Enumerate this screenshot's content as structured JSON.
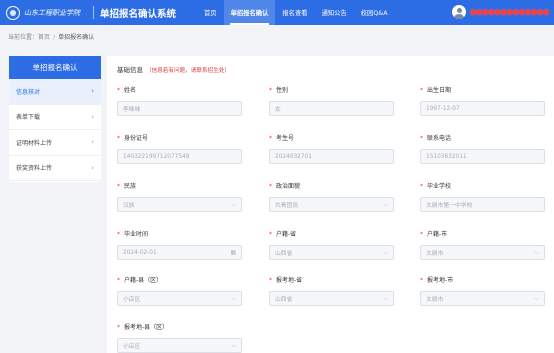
{
  "header": {
    "school_name": "山东工程职业学院",
    "system_title": "单招报名确认系统",
    "nav": [
      {
        "label": "首页",
        "active": false
      },
      {
        "label": "单招报名确认",
        "active": true
      },
      {
        "label": "报名查看",
        "active": false
      },
      {
        "label": "通知公告",
        "active": false
      },
      {
        "label": "校园Q&A",
        "active": false
      }
    ],
    "user_name": "●●●●●●●●●●●●●"
  },
  "breadcrumb": {
    "prefix": "当前位置：",
    "home": "首页",
    "separator": "/",
    "current": "单招报名确认"
  },
  "sidebar": {
    "title": "单招报名确认",
    "items": [
      {
        "label": "信息核对",
        "active": true
      },
      {
        "label": "表单下载",
        "active": false
      },
      {
        "label": "证明材料上传",
        "active": false
      },
      {
        "label": "获奖资料上传",
        "active": false
      }
    ]
  },
  "form": {
    "section_title": "基础信息",
    "note": "（信息若有问题，请联系招生处）",
    "fields": [
      {
        "label": "姓名",
        "value": "李咪咪",
        "type": "text"
      },
      {
        "label": "性别",
        "value": "女",
        "type": "text"
      },
      {
        "label": "出生日期",
        "value": "1997-12-07",
        "type": "text"
      },
      {
        "label": "身份证号",
        "value": "140322199712077548",
        "type": "text"
      },
      {
        "label": "考生号",
        "value": "2024032701",
        "type": "text"
      },
      {
        "label": "联系电话",
        "value": "15103632011",
        "type": "text"
      },
      {
        "label": "民族",
        "value": "汉族",
        "type": "select"
      },
      {
        "label": "政治面貌",
        "value": "共青团员",
        "type": "select"
      },
      {
        "label": "毕业学校",
        "value": "太原市第一中学校",
        "type": "text"
      },
      {
        "label": "毕业时间",
        "value": "2024-02-01",
        "type": "date"
      },
      {
        "label": "户籍-省",
        "value": "山西省",
        "type": "select"
      },
      {
        "label": "户籍-市",
        "value": "太原市",
        "type": "select"
      },
      {
        "label": "户籍-县（区）",
        "value": "小店区",
        "type": "select"
      },
      {
        "label": "报考地-省",
        "value": "山西省",
        "type": "select"
      },
      {
        "label": "报考地-市",
        "value": "太原市",
        "type": "select"
      },
      {
        "label": "报考地-县（区）",
        "value": "小店区",
        "type": "select"
      }
    ]
  },
  "icons": {
    "chevron": "chevron-right-icon",
    "dropdown": "chevron-down-icon",
    "calendar": "calendar-icon"
  },
  "colors": {
    "primary": "#2c6de6",
    "required": "#f04646",
    "note": "#e03b3b"
  }
}
